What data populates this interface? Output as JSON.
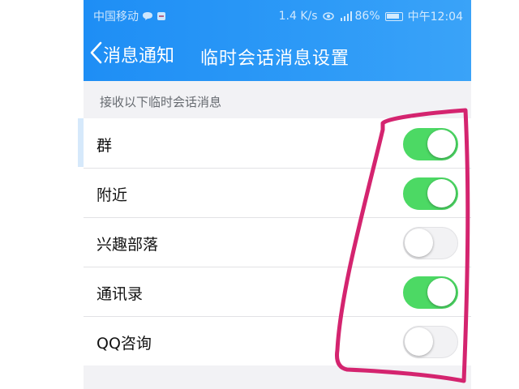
{
  "status_bar": {
    "carrier": "中国移动",
    "speed": "1.4 K/s",
    "battery": "86%",
    "time": "中午12:04"
  },
  "navbar": {
    "back_label": "消息通知",
    "title": "临时会话消息设置"
  },
  "section": {
    "header": "接收以下临时会话消息"
  },
  "settings": [
    {
      "label": "群",
      "enabled": true
    },
    {
      "label": "附近",
      "enabled": true
    },
    {
      "label": "兴趣部落",
      "enabled": false
    },
    {
      "label": "通讯录",
      "enabled": true
    },
    {
      "label": "QQ咨询",
      "enabled": false
    }
  ],
  "colors": {
    "header_blue": "#1e8ef5",
    "toggle_on": "#4cd964",
    "annotation": "#d4246f"
  }
}
